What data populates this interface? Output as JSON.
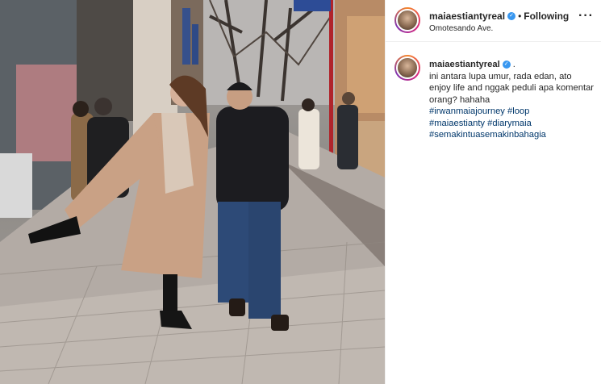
{
  "post": {
    "username": "maiaestiantyreal",
    "follow_status": "Following",
    "separator": "•",
    "location": "Omotesando Ave.",
    "more_icon": "more-horizontal-icon",
    "verified_icon": "verified-badge-icon"
  },
  "caption": {
    "username": "maiaestiantyreal",
    "trailing": ".",
    "text": "ini antara lupa umur, rada edan, ato enjoy life and nggak peduli apa komentar orang? hahaha",
    "hashtags": [
      "#irwanmaiajourney #loop",
      "#maiaestianty #diarymaia",
      "#semakintuasemakinbahagia"
    ]
  },
  "media": {
    "street_sign": "✕ "
  },
  "colors": {
    "link": "#00376b",
    "verified": "#3897f0",
    "text": "#262626"
  }
}
